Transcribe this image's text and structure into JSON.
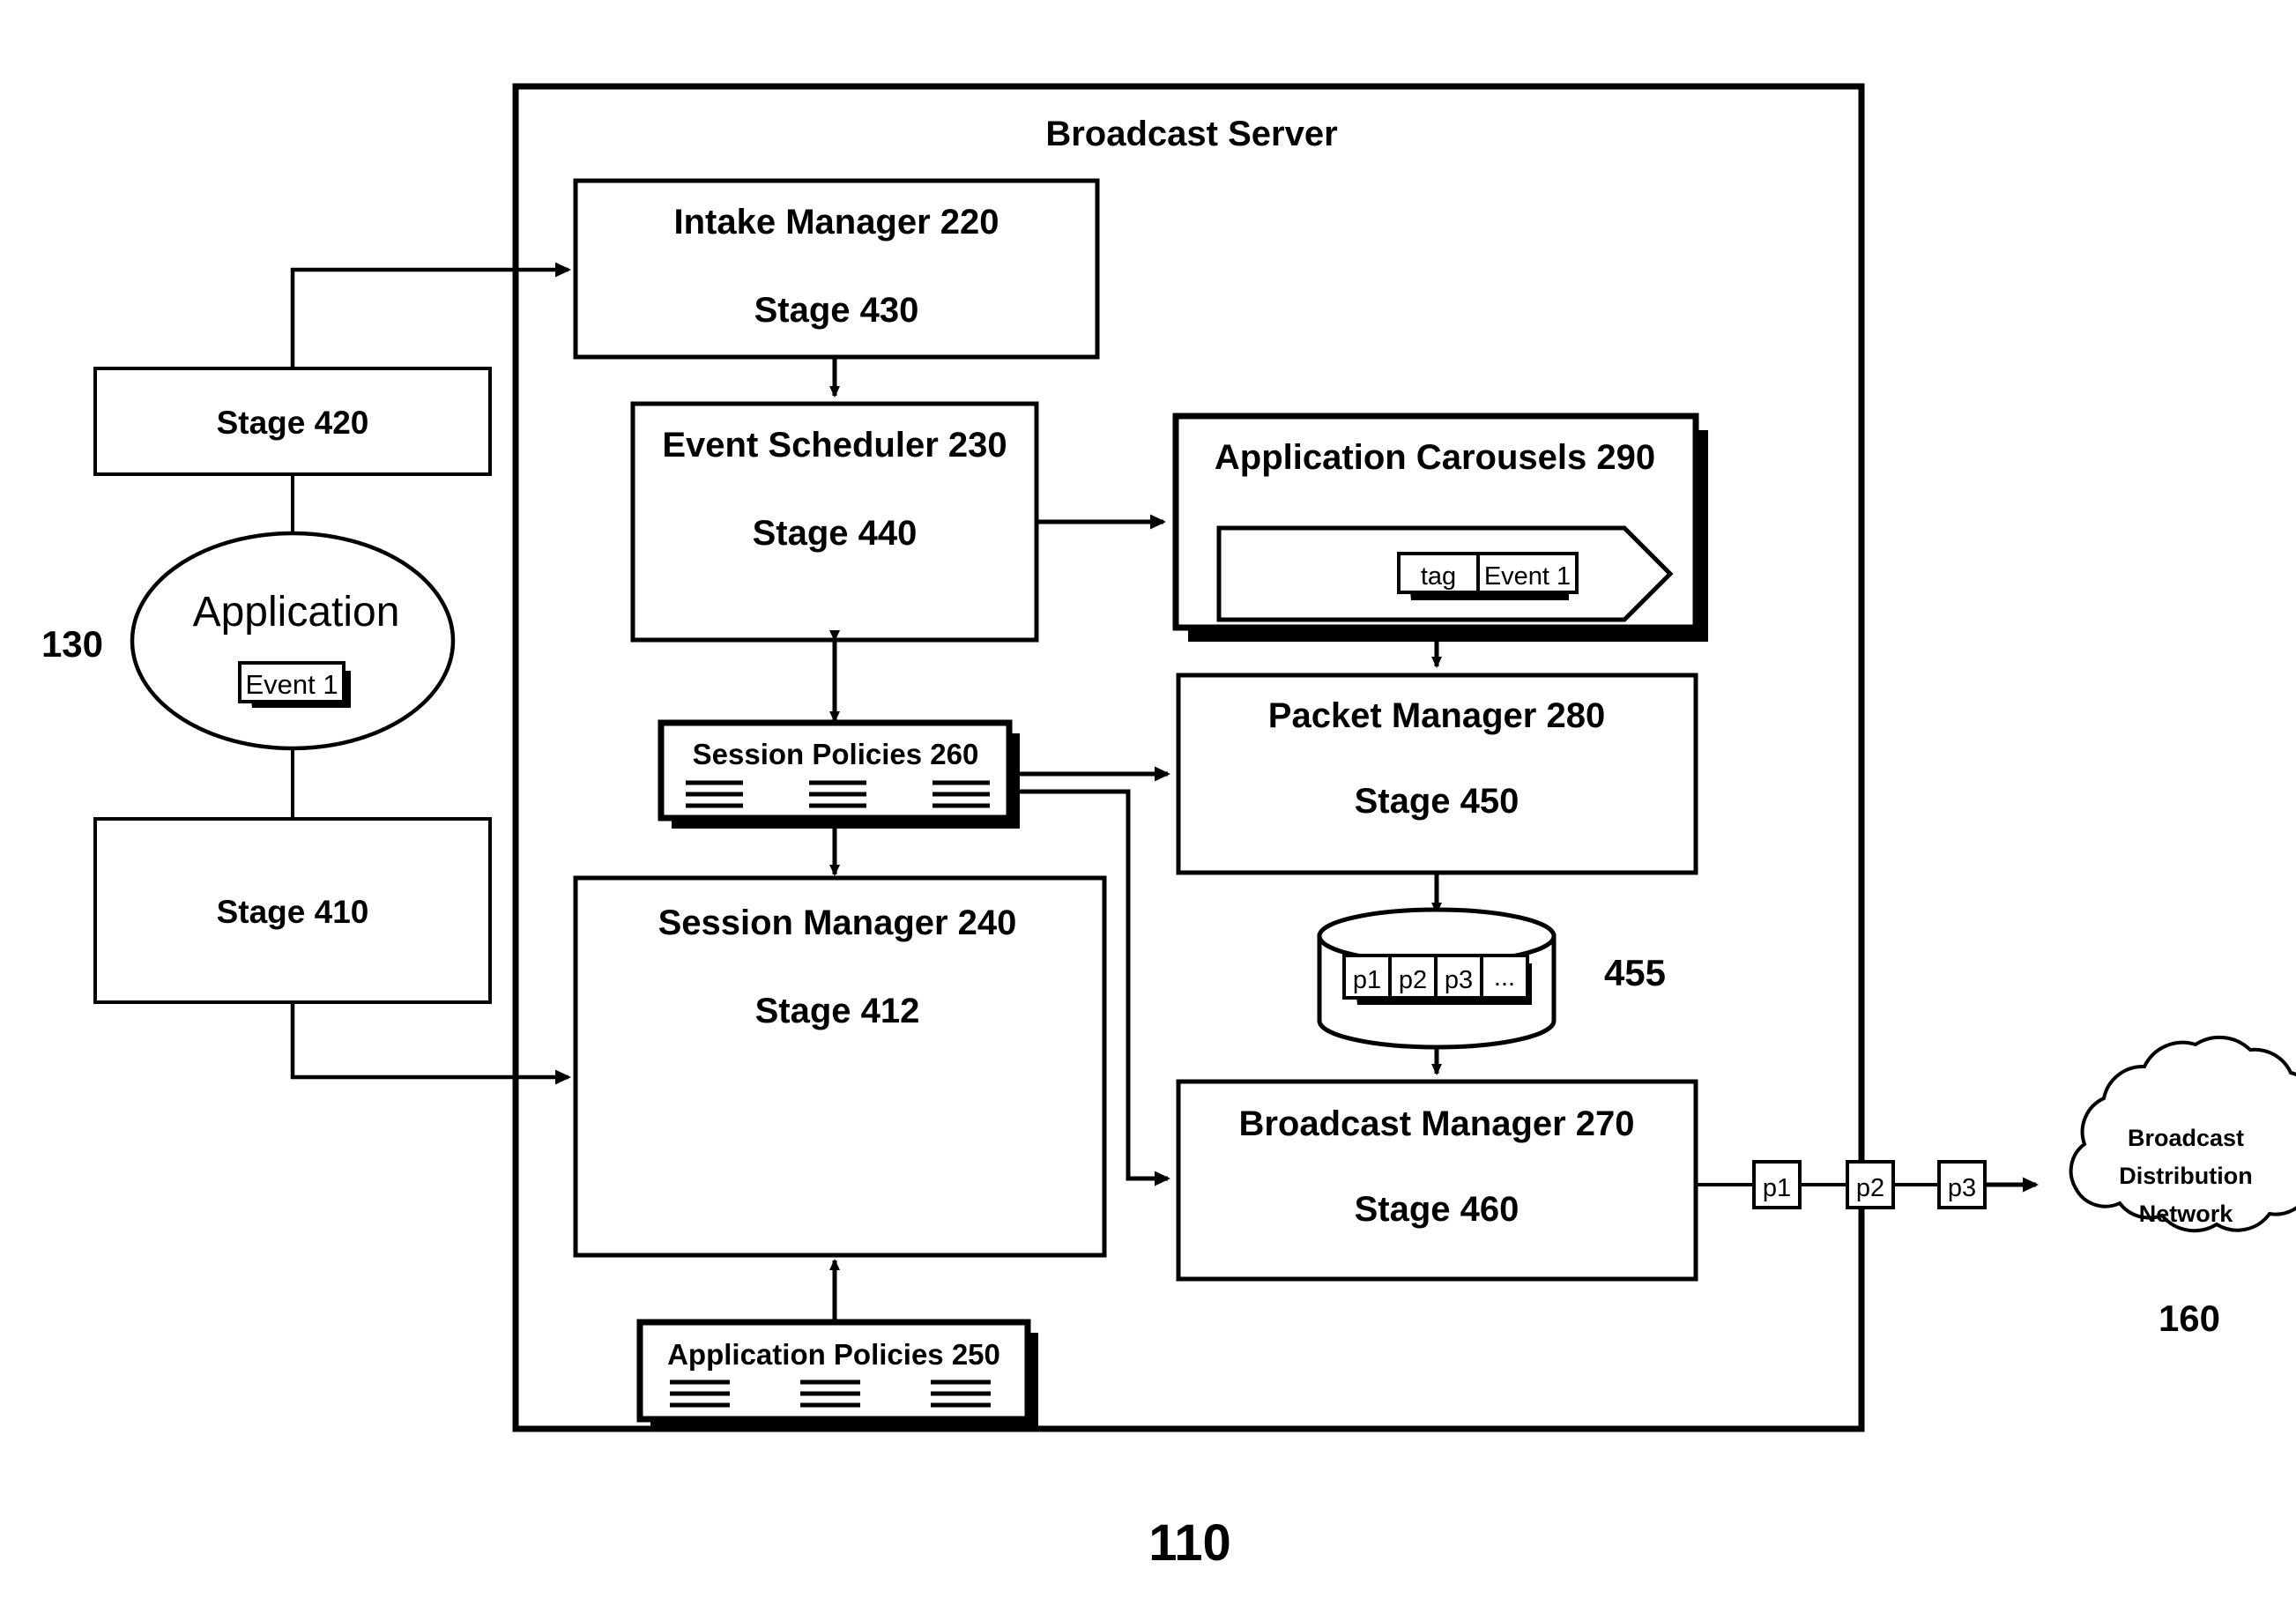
{
  "figure": {
    "container_title": "Broadcast Server",
    "figure_ref": "110",
    "app_ref": "130",
    "network_ref": "160",
    "packet_store_ref": "455"
  },
  "nodes": {
    "intake_manager": {
      "title": "Intake Manager 220",
      "stage": "Stage 430"
    },
    "event_scheduler": {
      "title": "Event Scheduler 230",
      "stage": "Stage 440"
    },
    "session_manager": {
      "title": "Session Manager 240",
      "stage": "Stage 412"
    },
    "packet_manager": {
      "title": "Packet Manager 280",
      "stage": "Stage 450"
    },
    "broadcast_manager": {
      "title": "Broadcast Manager 270",
      "stage": "Stage 460"
    },
    "application_carousels": {
      "title": "Application Carousels 290"
    },
    "session_policies": {
      "title": "Session Policies 260"
    },
    "application_policies": {
      "title": "Application Policies 250"
    },
    "application": {
      "title": "Application",
      "event": "Event 1"
    },
    "stage_420": {
      "title": "Stage 420"
    },
    "stage_410": {
      "title": "Stage 410"
    },
    "carousel_event": {
      "tag": "tag",
      "event": "Event 1"
    },
    "broadcast_network": {
      "line1": "Broadcast",
      "line2": "Distribution",
      "line3": "Network"
    }
  },
  "packet_store": {
    "cells": [
      "p1",
      "p2",
      "p3",
      "..."
    ]
  },
  "output_packets": [
    "p1",
    "p2",
    "p3"
  ],
  "colors": {
    "stroke": "#000000",
    "fill": "#ffffff"
  }
}
